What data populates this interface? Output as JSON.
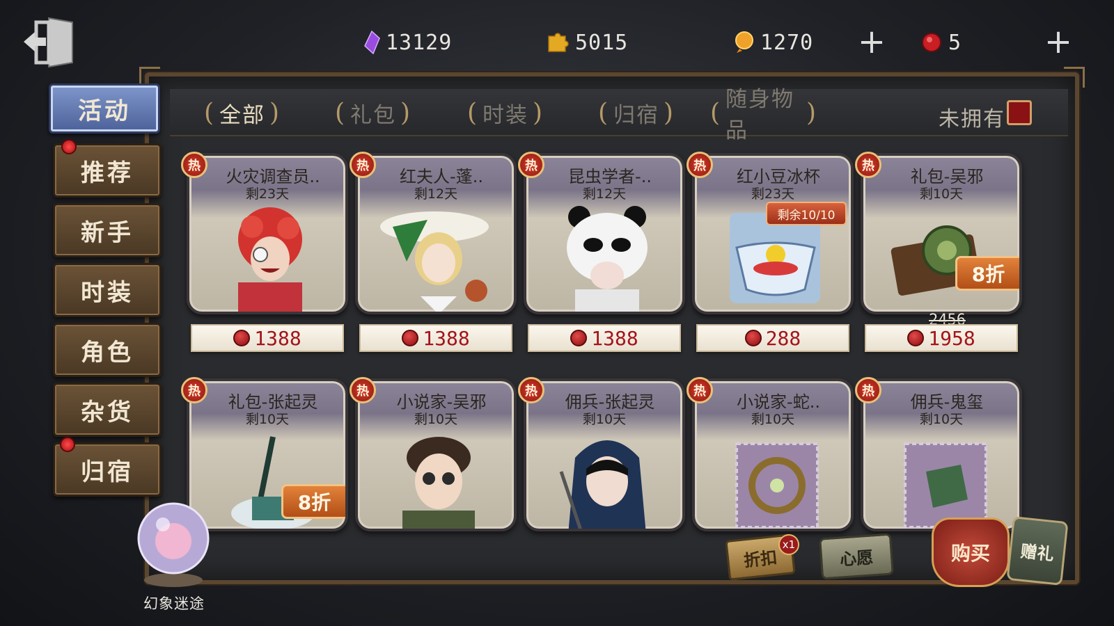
{
  "currencies": [
    {
      "name": "gem-currency",
      "value": "13129"
    },
    {
      "name": "puzzle-currency",
      "value": "5015"
    },
    {
      "name": "coin-currency",
      "value": "1270"
    },
    {
      "name": "echo-currency",
      "value": "5"
    }
  ],
  "plus_glyph": "+",
  "nav": [
    {
      "label": "活动",
      "active": true
    },
    {
      "label": "推荐"
    },
    {
      "label": "新手"
    },
    {
      "label": "时装"
    },
    {
      "label": "角色"
    },
    {
      "label": "杂货"
    },
    {
      "label": "归宿"
    }
  ],
  "tabs": [
    {
      "label": "全部",
      "active": true
    },
    {
      "label": "礼包"
    },
    {
      "label": "时装"
    },
    {
      "label": "归宿"
    },
    {
      "label": "随身物品"
    }
  ],
  "unowned_label": "未拥有",
  "hot_label": "热",
  "items": [
    {
      "title": "火灾调查员..",
      "days": "剩23天",
      "price": "1388"
    },
    {
      "title": "红夫人-蓬..",
      "days": "剩12天",
      "price": "1388"
    },
    {
      "title": "昆虫学者-..",
      "days": "剩12天",
      "price": "1388"
    },
    {
      "title": "红小豆冰杯",
      "days": "剩23天",
      "price": "288",
      "stock": "剩余10/10"
    },
    {
      "title": "礼包-吴邪",
      "days": "剩10天",
      "price": "1958",
      "original_price": "2456",
      "discount": "8折"
    },
    {
      "title": "礼包-张起灵",
      "days": "剩10天",
      "discount": "8折"
    },
    {
      "title": "小说家-吴邪",
      "days": "剩10天"
    },
    {
      "title": "佣兵-张起灵",
      "days": "剩10天"
    },
    {
      "title": "小说家-蛇..",
      "days": "剩10天"
    },
    {
      "title": "佣兵-鬼玺",
      "days": "剩10天"
    }
  ],
  "orb_label": "幻象迷途",
  "bottom_buttons": {
    "coupon": "折扣",
    "coupon_count": "x1",
    "wish": "心愿",
    "buy": "购买",
    "gift": "赠礼"
  },
  "colors": {
    "accent_blue": "#4c6199",
    "wood": "#5b4630",
    "price_red": "#a3141b",
    "discount_orange": "#e2823a"
  }
}
